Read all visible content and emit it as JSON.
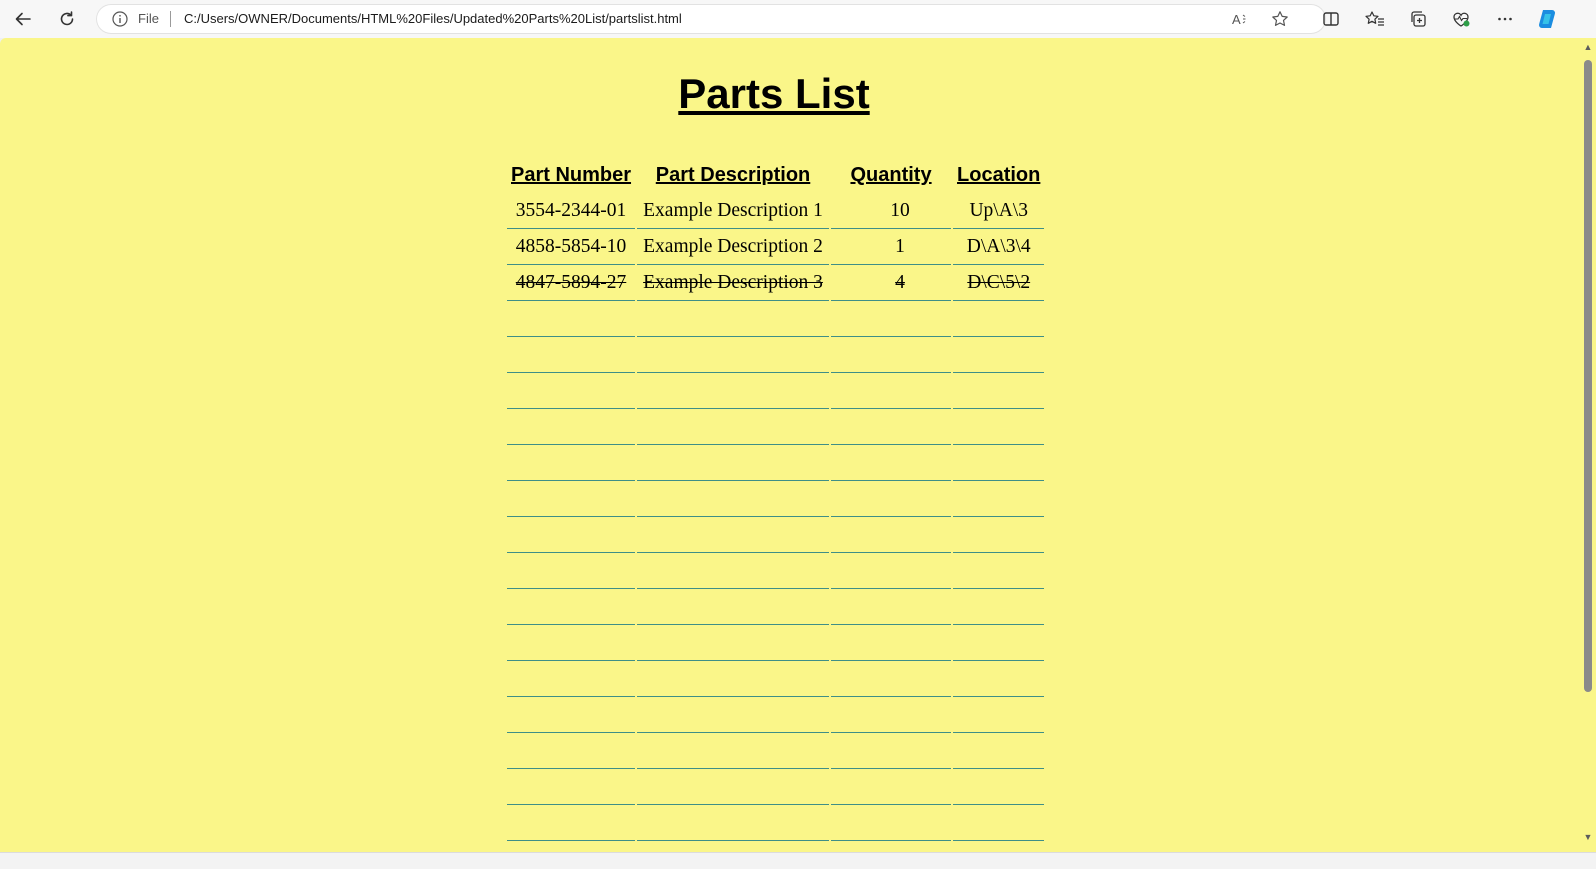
{
  "browser": {
    "address_scheme_label": "File",
    "address_url": "C:/Users/OWNER/Documents/HTML%20Files/Updated%20Parts%20List/partslist.html",
    "icons": [
      "back-icon",
      "refresh-icon",
      "info-icon",
      "read-aloud-icon",
      "favorite-star-icon",
      "split-screen-icon",
      "favorites-icon",
      "collections-icon",
      "browser-essentials-icon",
      "more-icon",
      "copilot-icon"
    ]
  },
  "colors": {
    "page_background": "#faf689",
    "row_rule": "#3f8f87"
  },
  "page": {
    "title": "Parts List",
    "table": {
      "headers": [
        "Part Number",
        "Part Description",
        "Quantity",
        "Location"
      ],
      "rows": [
        {
          "part_number": "3554-2344-01",
          "description": "Example Description 1",
          "quantity": "10",
          "location": "Up\\A\\3",
          "struck": false
        },
        {
          "part_number": "4858-5854-10",
          "description": "Example Description 2",
          "quantity": "1",
          "location": "D\\A\\3\\4",
          "struck": false
        },
        {
          "part_number": "4847-5894-27",
          "description": "Example Description 3",
          "quantity": "4",
          "location": "D\\C\\5\\2",
          "struck": true
        }
      ],
      "empty_row_count": 15
    }
  }
}
